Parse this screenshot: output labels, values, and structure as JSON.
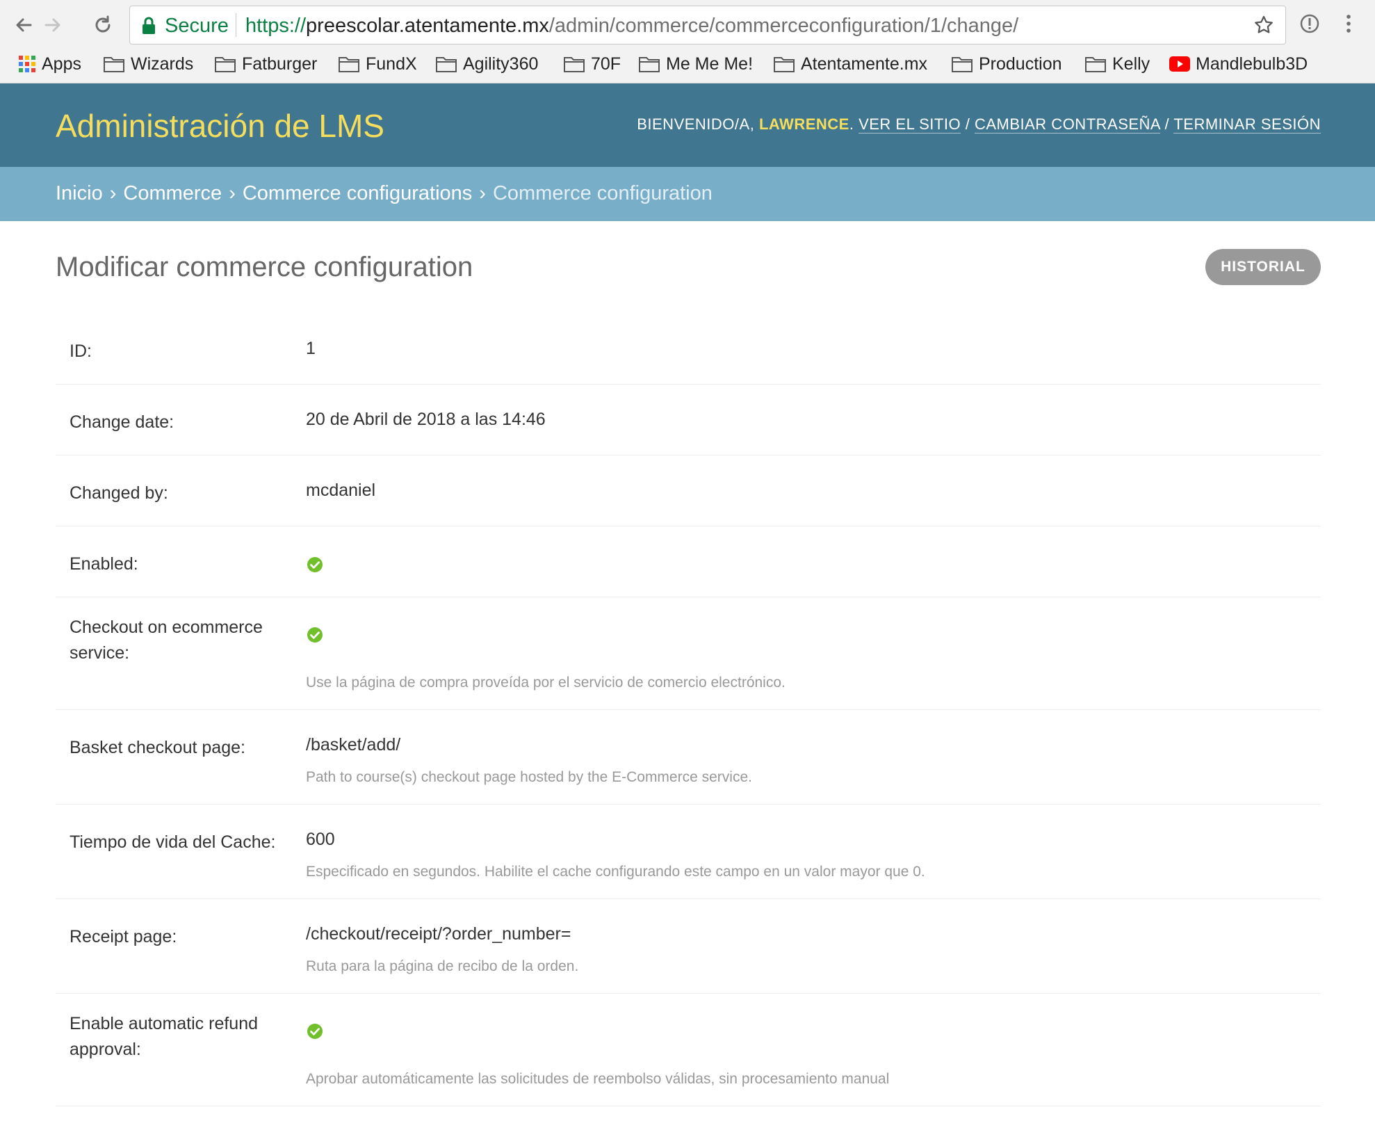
{
  "browser": {
    "secure_label": "Secure",
    "url_scheme": "https://",
    "url_host": "preescolar.atentamente.mx",
    "url_path": "/admin/commerce/commerceconfiguration/1/change/",
    "bookmarks": [
      {
        "label": "Apps",
        "icon": "apps-grid-icon"
      },
      {
        "label": "Wizards",
        "icon": "folder-icon"
      },
      {
        "label": "Fatburger",
        "icon": "folder-icon"
      },
      {
        "label": "FundX",
        "icon": "folder-icon"
      },
      {
        "label": "Agility360",
        "icon": "folder-icon"
      },
      {
        "label": "70F",
        "icon": "folder-icon"
      },
      {
        "label": "Me Me Me!",
        "icon": "folder-icon"
      },
      {
        "label": "Atentamente.mx",
        "icon": "folder-icon"
      },
      {
        "label": "Production",
        "icon": "folder-icon"
      },
      {
        "label": "Kelly",
        "icon": "folder-icon"
      },
      {
        "label": "Mandlebulb3D",
        "icon": "youtube-icon"
      }
    ]
  },
  "header": {
    "brand": "Administración de LMS",
    "welcome": "BIENVENIDO/A,",
    "username": "LAWRENCE",
    "view_site": "VER EL SITIO",
    "change_password": "CAMBIAR CONTRASEÑA",
    "logout": "TERMINAR SESIÓN",
    "separator": "/"
  },
  "breadcrumbs": {
    "items": [
      "Inicio",
      "Commerce",
      "Commerce configurations"
    ],
    "current": "Commerce configuration",
    "separator": "›"
  },
  "page": {
    "title": "Modificar commerce configuration",
    "history_button": "HISTORIAL"
  },
  "fields": {
    "id": {
      "label": "ID:",
      "value": "1"
    },
    "change_date": {
      "label": "Change date:",
      "value": "20 de Abril de 2018 a las 14:46"
    },
    "changed_by": {
      "label": "Changed by:",
      "value": "mcdaniel"
    },
    "enabled": {
      "label": "Enabled:",
      "value": true,
      "icon": "check-circle-icon"
    },
    "checkout_on_ecommerce": {
      "label": "Checkout on ecommerce service:",
      "value": true,
      "icon": "check-circle-icon",
      "help": "Use la página de compra proveída por el servicio de comercio electrónico."
    },
    "basket_checkout_page": {
      "label": "Basket checkout page:",
      "value": "/basket/add/",
      "help": "Path to course(s) checkout page hosted by the E-Commerce service."
    },
    "cache_ttl": {
      "label": "Tiempo de vida del Cache:",
      "value": "600",
      "help": "Especificado en segundos. Habilite el cache configurando este campo en un valor mayor que 0."
    },
    "receipt_page": {
      "label": "Receipt page:",
      "value": "/checkout/receipt/?order_number=",
      "help": "Ruta para la página de recibo de la orden."
    },
    "auto_refund": {
      "label": "Enable automatic refund approval:",
      "value": true,
      "icon": "check-circle-icon",
      "help": "Aprobar automáticamente las solicitudes de reembolso válidas, sin procesamiento manual"
    }
  },
  "colors": {
    "header_bg": "#417690",
    "breadcrumb_bg": "#79aec8",
    "brand": "#f5dd5d",
    "check_green": "#70bf2b",
    "history_button_bg": "#999999",
    "secure_green": "#0b8043"
  }
}
